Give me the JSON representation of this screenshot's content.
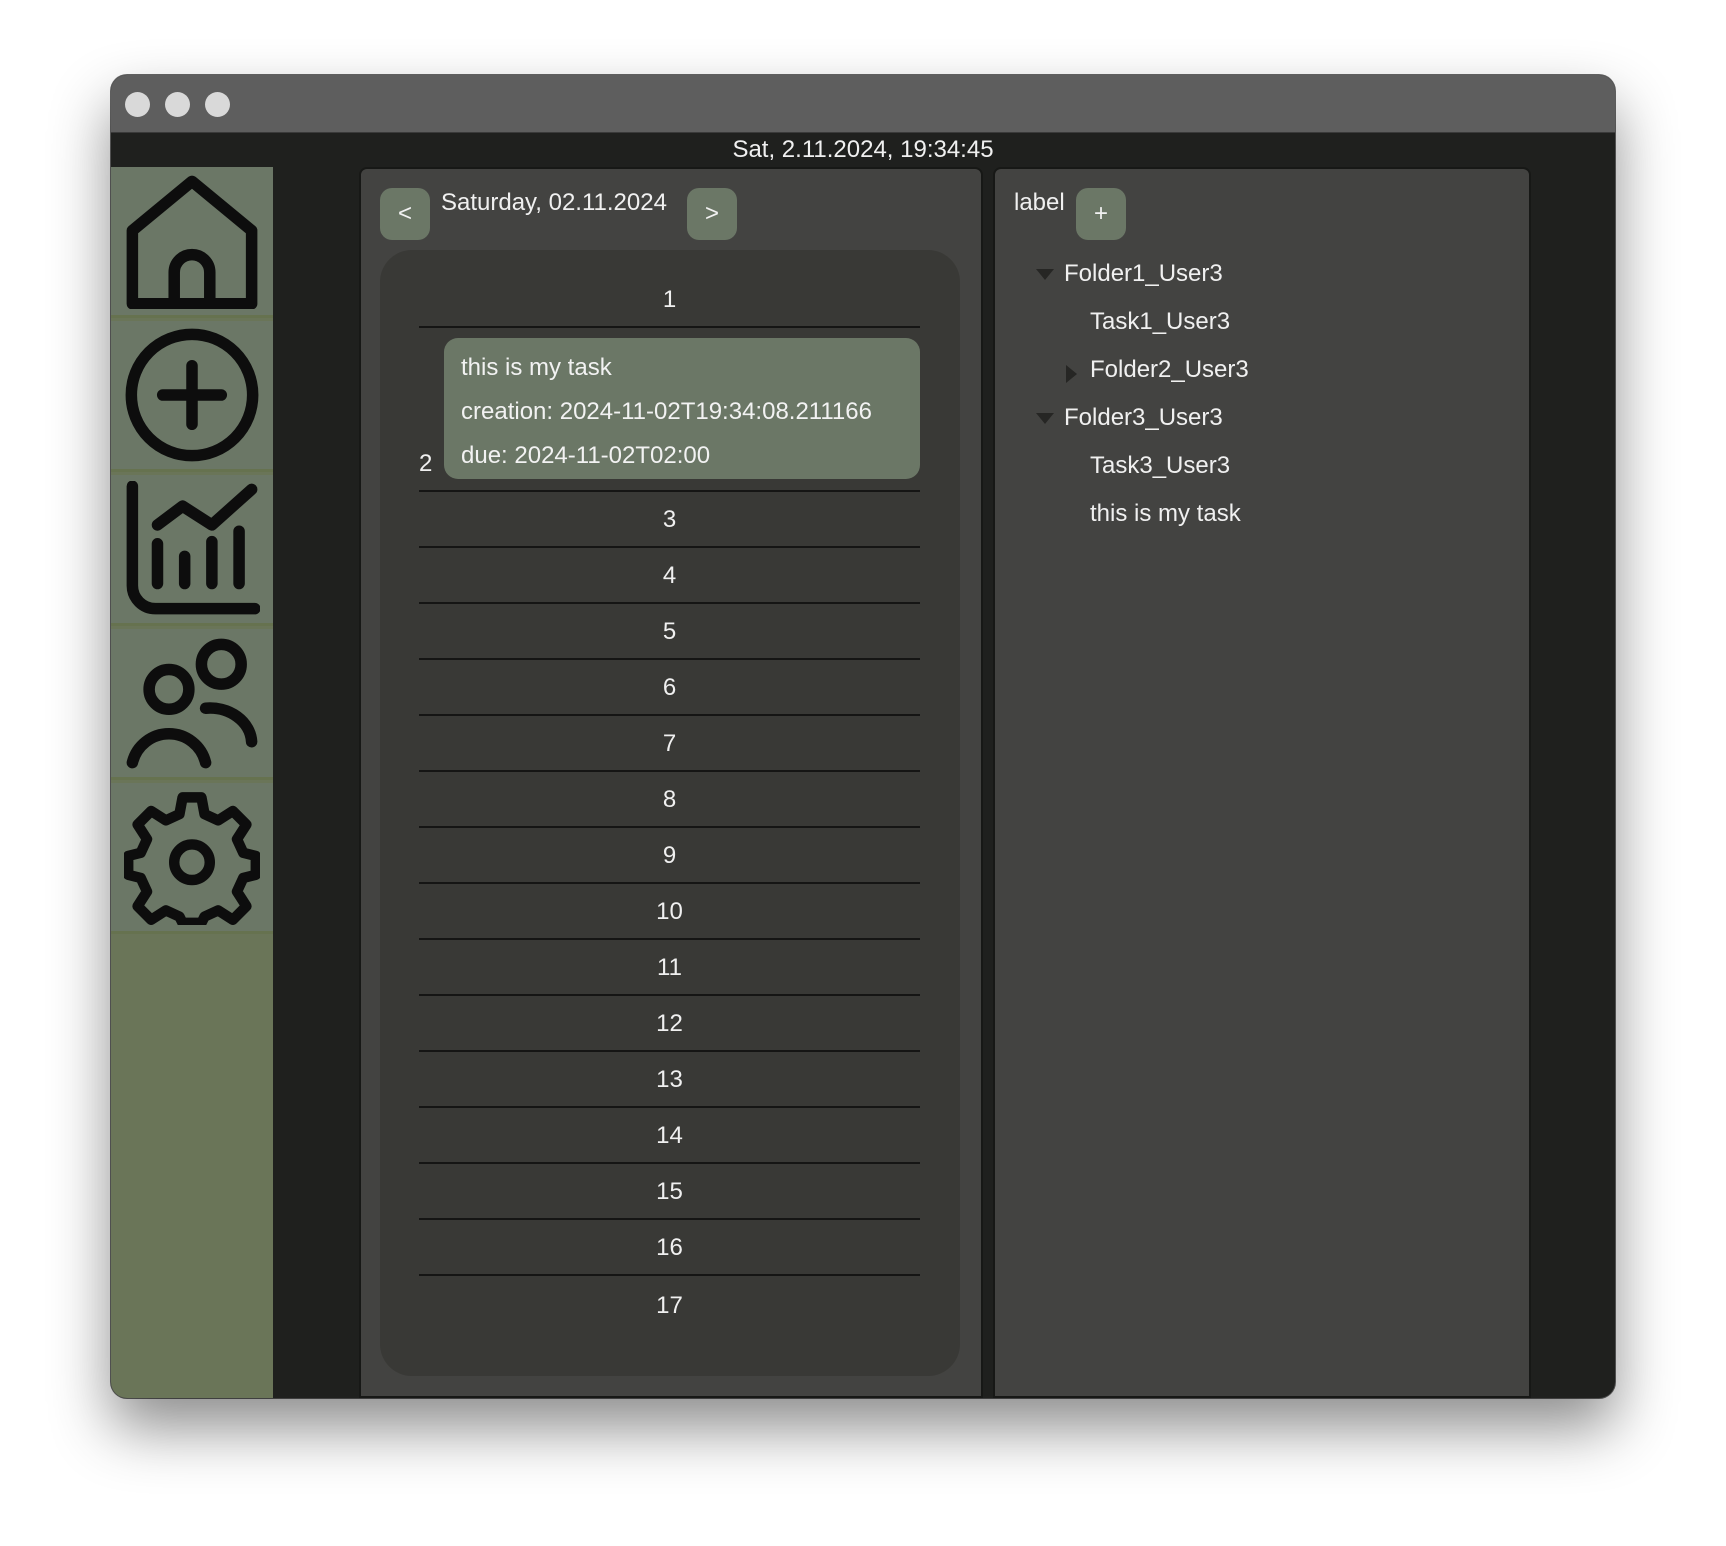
{
  "window": {
    "clock": "Sat, 2.11.2024, 19:34:45"
  },
  "sidebar": {
    "items": [
      {
        "name": "home",
        "icon": "home-icon"
      },
      {
        "name": "add",
        "icon": "plus-circle-icon"
      },
      {
        "name": "statistics",
        "icon": "chart-icon"
      },
      {
        "name": "users",
        "icon": "users-icon"
      },
      {
        "name": "settings",
        "icon": "gear-icon"
      }
    ]
  },
  "day_view": {
    "prev_label": "<",
    "next_label": ">",
    "date": "Saturday, 02.11.2024",
    "hours": [
      "1",
      "2",
      "3",
      "4",
      "5",
      "6",
      "7",
      "8",
      "9",
      "10",
      "11",
      "12",
      "13",
      "14",
      "15",
      "16",
      "17"
    ],
    "task": {
      "title": "this is my task",
      "creation": "creation: 2024-11-02T19:34:08.211166",
      "due": "due: 2024-11-02T02:00"
    }
  },
  "tree_panel": {
    "label": "label",
    "add_label": "+",
    "items": [
      {
        "label": "Folder1_User3",
        "expander": "expanded"
      },
      {
        "label": "Task1_User3",
        "expander": "none"
      },
      {
        "label": "Folder2_User3",
        "expander": "collapsed"
      },
      {
        "label": "Folder3_User3",
        "expander": "expanded"
      },
      {
        "label": "Task3_User3",
        "expander": "none"
      },
      {
        "label": "this is my task",
        "expander": "none"
      }
    ]
  },
  "colors": {
    "accent": "#6b7766",
    "sidebar": "#6a7558",
    "panel": "#434341",
    "background": "#1f201e"
  }
}
